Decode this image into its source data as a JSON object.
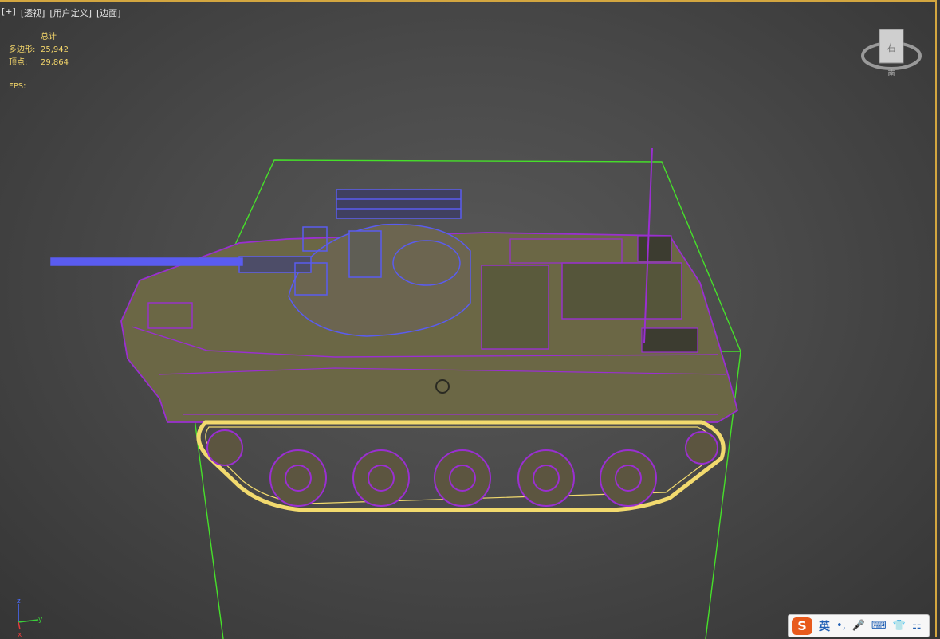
{
  "viewport": {
    "menu": [
      "[+]",
      "[透视]",
      "[用户定义]",
      "[边面]"
    ]
  },
  "stats": {
    "header": "总计",
    "polygons_label": "多边形:",
    "polygons_value": "25,942",
    "vertices_label": "顶点:",
    "vertices_value": "29,864",
    "fps_label": "FPS:"
  },
  "viewcube": {
    "face_label": "右",
    "compass_label": "南"
  },
  "axes": {
    "z": "z",
    "y": "y",
    "x": "x"
  },
  "ime": {
    "logo": "S",
    "lang": "英",
    "icons": [
      "punctuation-icon",
      "microphone-icon",
      "keyboard-icon",
      "skin-icon",
      "toolbox-icon"
    ],
    "glyphs": [
      "•,",
      "🎤",
      "⌨",
      "👕",
      "⚏"
    ]
  },
  "colors": {
    "accent_border": "#d3a640",
    "bounding_box": "#46e02a",
    "wire_body": "#9a2fd1",
    "wire_turret": "#5a5cf0",
    "wire_tracks": "#f2da6e",
    "stat_text": "#f3d56a"
  }
}
